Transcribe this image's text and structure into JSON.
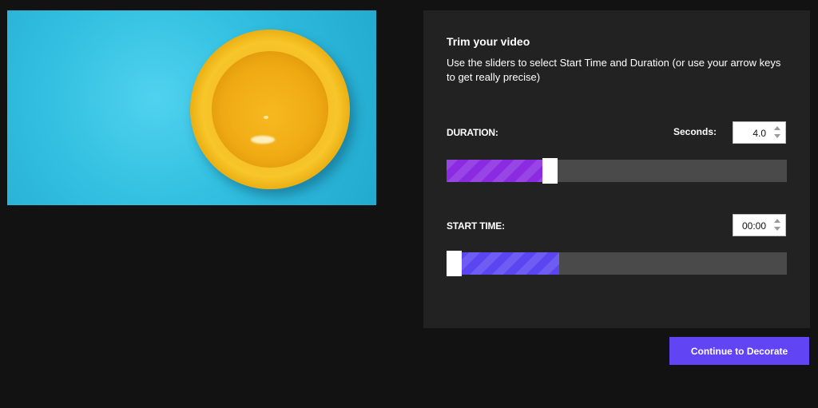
{
  "trim": {
    "title": "Trim your video",
    "description": "Use the sliders to select Start Time and Duration (or use your arrow keys to get really precise)",
    "duration": {
      "label": "DURATION:",
      "seconds_label": "Seconds:",
      "seconds_value": "4.0",
      "slider_fraction": 0.305
    },
    "start_time": {
      "label": "START TIME:",
      "value": "00:00",
      "slider_start_fraction": 0.0,
      "slider_end_fraction": 0.33
    }
  },
  "actions": {
    "continue_label": "Continue to Decorate"
  },
  "colors": {
    "background": "#121212",
    "panel": "#222222",
    "duration_fill": "#8a2be2",
    "start_fill": "#5b45f0",
    "button": "#6145f5",
    "track": "#4a4a4a"
  },
  "icons": {
    "spin_up": "chevron-up-icon",
    "spin_down": "chevron-down-icon"
  }
}
